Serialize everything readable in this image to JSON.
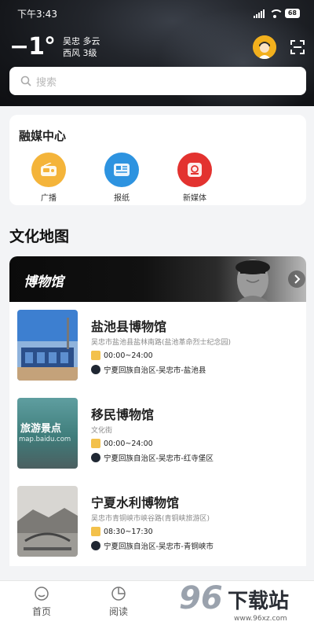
{
  "status_bar": {
    "time": "下午3:43",
    "battery": "68"
  },
  "weather": {
    "temperature": "−1°",
    "location_condition": "吴忠 多云",
    "wind": "西风 3级"
  },
  "search": {
    "placeholder": "搜索"
  },
  "media_center": {
    "title": "融媒中心",
    "items": [
      {
        "label": "广播",
        "color": "#f4b43a",
        "icon": "radio-icon"
      },
      {
        "label": "报纸",
        "color": "#2d93e0",
        "icon": "newspaper-icon"
      },
      {
        "label": "新媒体",
        "color": "#e3322f",
        "icon": "new-media-icon"
      }
    ]
  },
  "culture_map": {
    "title": "文化地图",
    "banner_title": "博物馆",
    "museums": [
      {
        "name": "盐池县博物馆",
        "address": "吴忠市盐池县盐林南路(盐池革命烈士纪念园)",
        "hours": "00:00~24:00",
        "region": "宁夏回族自治区-吴忠市-盐池县"
      },
      {
        "name": "移民博物馆",
        "address": "文化街",
        "hours": "00:00~24:00",
        "region": "宁夏回族自治区-吴忠市-红寺堡区",
        "thumb_text": "旅游景点",
        "thumb_subtext": "map.baidu.com"
      },
      {
        "name": "宁夏水利博物馆",
        "address": "吴忠市青铜峡市峡谷路(青铜峡旅游区)",
        "hours": "08:30~17:30",
        "region": "宁夏回族自治区-吴忠市-青铜峡市"
      }
    ]
  },
  "bottom_nav": {
    "items": [
      {
        "label": "首页"
      },
      {
        "label": "阅读"
      }
    ]
  },
  "watermark": {
    "number": "96",
    "text": "下载站",
    "url": "www.96xz.com"
  }
}
